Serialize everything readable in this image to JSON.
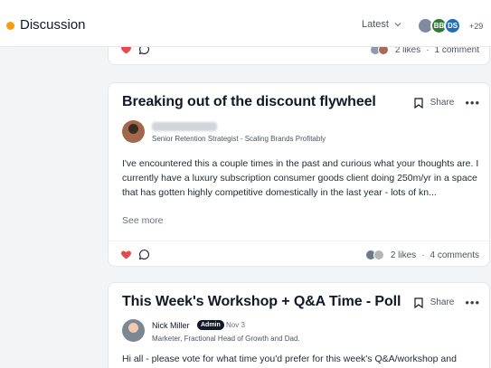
{
  "header": {
    "title": "Discussion",
    "sort_label": "Latest",
    "avatars": [
      "",
      "BB",
      "DS"
    ],
    "more_count": "+29"
  },
  "posts": [
    {
      "likes": "2 likes",
      "comments": "1 comment"
    },
    {
      "title": "Breaking out of the discount flywheel",
      "share_label": "Share",
      "author_role": "Senior Retention Strategist - Scaling Brands Profitably",
      "excerpt": "I've encountered this a couple times in the past and curious what your thoughts are. I currently have a luxury subscription consumer goods client  doing 250m/yr in a space that has  gotten highly competitive domestically in the last year - lots of kn...",
      "see_more": "See more",
      "likes": "2 likes",
      "comments": "4 comments"
    },
    {
      "title": "This Week's Workshop + Q&A Time - Poll",
      "share_label": "Share",
      "author_name": "Nick Miller",
      "author_badge": "Admin",
      "date": "Nov 3",
      "author_role": "Marketer, Fractional Head of Growth and Dad.",
      "excerpt": "Hi all - please vote for what time you'd prefer for this week's Q&A/workshop and"
    }
  ],
  "colors": {
    "accent": "#f59e0b",
    "heart": "#e5484d"
  }
}
